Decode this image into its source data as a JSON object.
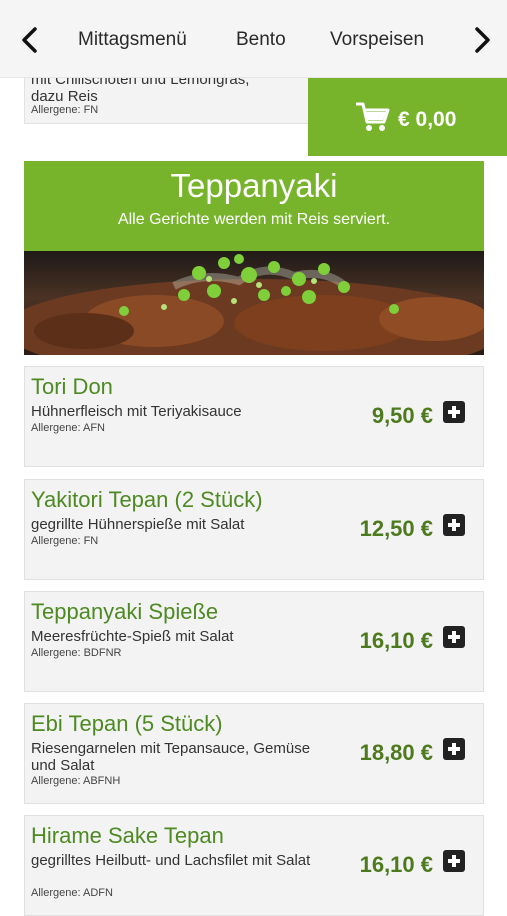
{
  "nav": {
    "tabs": [
      "Mittagsmenü",
      "Bento",
      "Vorspeisen"
    ]
  },
  "cart": {
    "total": "€ 0,00"
  },
  "previous_item": {
    "desc_line1": "mit Chilischoten und Lemongras,",
    "desc_line2": "dazu Reis",
    "allergens": "Allergene: FN"
  },
  "category": {
    "title": "Teppanyaki",
    "subtitle": "Alle Gerichte werden mit Reis serviert."
  },
  "items": [
    {
      "name": "Tori Don",
      "desc": "Hühnerfleisch mit Teriyakisauce",
      "allergens": "Allergene: AFN",
      "price": "9,50 €"
    },
    {
      "name": "Yakitori Tepan (2 Stück)",
      "desc": "gegrillte Hühnerspieße mit Salat",
      "allergens": "Allergene: FN",
      "price": "12,50 €"
    },
    {
      "name": "Teppanyaki Spieße",
      "desc": "Meeresfrüchte-Spieß mit Salat",
      "allergens": "Allergene: BDFNR",
      "price": "16,10 €"
    },
    {
      "name": "Ebi Tepan (5 Stück)",
      "desc": "Riesengarnelen mit Tepansauce, Gemüse und Salat",
      "allergens": "Allergene: ABFNH",
      "price": "18,80 €"
    },
    {
      "name": "Hirame Sake Tepan",
      "desc": "gegrilltes Heilbutt- und Lachsfilet mit Salat",
      "allergens": "Allergene: ADFN",
      "price": "16,10 €"
    }
  ],
  "colors": {
    "accent": "#77b42c",
    "item_name": "#4e8a22",
    "price": "#4e7a1e"
  },
  "icons": [
    "chevron-left-icon",
    "chevron-right-icon",
    "cart-icon",
    "plus-icon"
  ]
}
